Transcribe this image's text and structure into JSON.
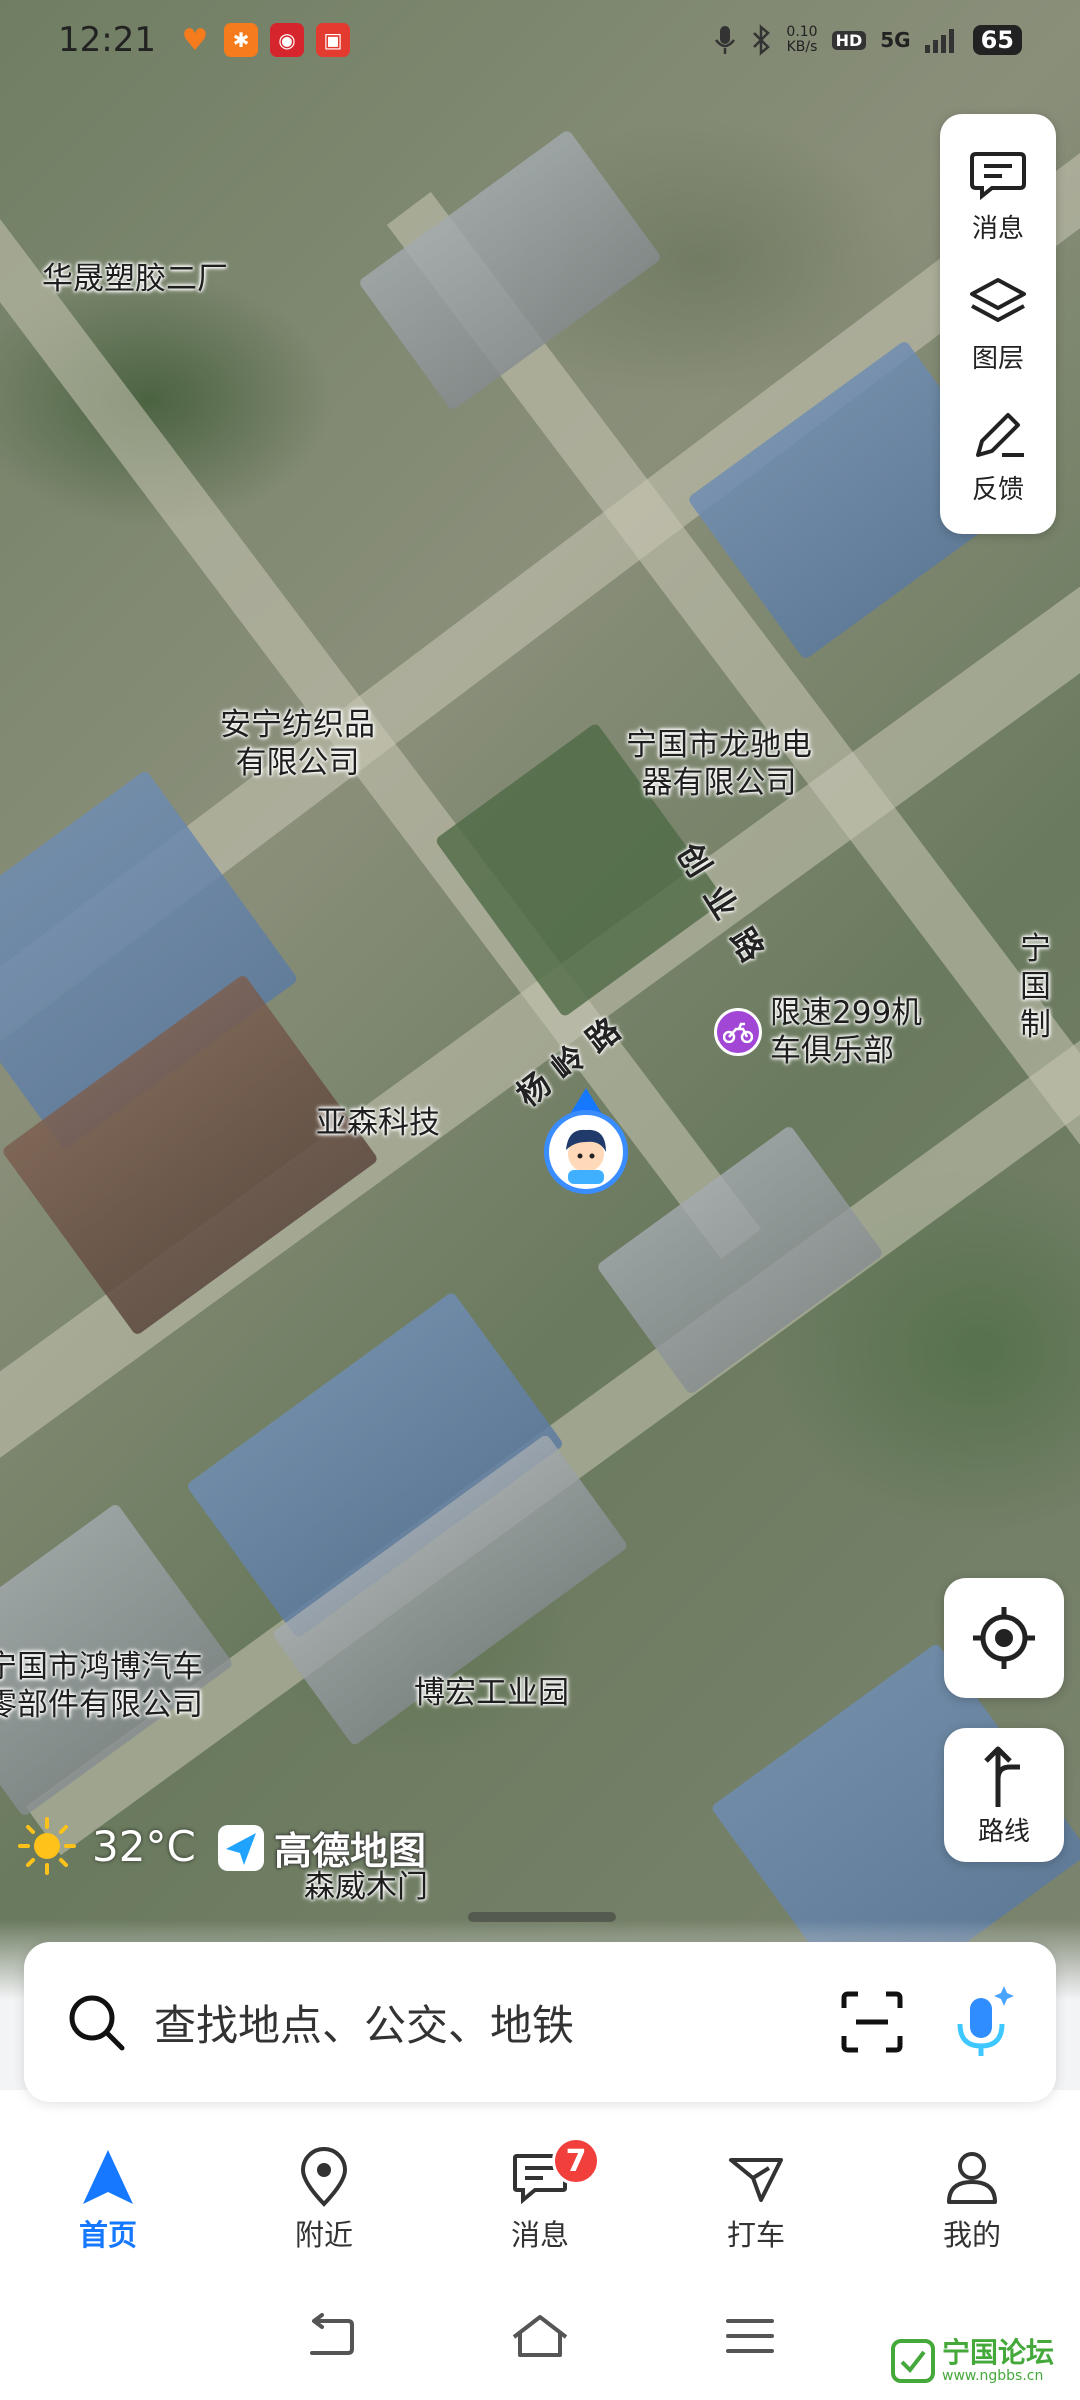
{
  "status_bar": {
    "time": "12:21",
    "net_speed": "0.10\nKB/s",
    "battery": "65",
    "hd": "HD",
    "network": "5G"
  },
  "map": {
    "labels": [
      "华晟塑胶二厂",
      "安宁纺织品\n有限公司",
      "宁国市龙驰电\n器有限公司",
      "限速299机\n车俱乐部",
      "亚森科技",
      "宁国市鸿博汽车\n零部件有限公司",
      "博宏工业园",
      "森威木门",
      "宁国\n制"
    ],
    "road_labels": [
      "创业路",
      "杨岭路"
    ]
  },
  "tools": {
    "messages": "消息",
    "layers": "图层",
    "feedback": "反馈"
  },
  "route_button": "路线",
  "weather": {
    "temp": "32°C"
  },
  "brand": "高德地图",
  "search": {
    "placeholder": "查找地点、公交、地铁"
  },
  "tabs": [
    {
      "label": "首页",
      "active": true
    },
    {
      "label": "附近"
    },
    {
      "label": "消息",
      "badge": "7"
    },
    {
      "label": "打车"
    },
    {
      "label": "我的"
    }
  ],
  "watermark": {
    "name": "宁国论坛",
    "url": "www.ngbbs.cn"
  },
  "colors": {
    "accent": "#1677ff",
    "badge": "#f1403c",
    "poi_purple": "#a246d6"
  }
}
